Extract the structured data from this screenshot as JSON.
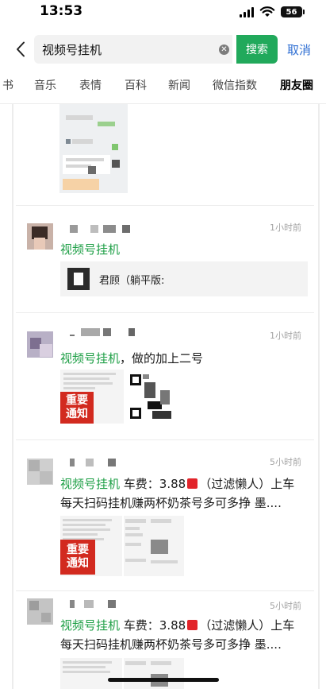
{
  "status": {
    "time": "13:53",
    "battery": "56"
  },
  "search": {
    "query": "视频号挂机",
    "search_label": "搜索",
    "cancel_label": "取消"
  },
  "tabs": [
    {
      "label": "书"
    },
    {
      "label": "音乐"
    },
    {
      "label": "表情"
    },
    {
      "label": "百科"
    },
    {
      "label": "新闻"
    },
    {
      "label": "微信指数"
    },
    {
      "label": "朋友圈",
      "active": true
    }
  ],
  "feed": {
    "posts": [
      {
        "time": "1小时前",
        "keyword": "视频号挂机",
        "link_title": "君顾（躺平版:"
      },
      {
        "time": "1小时前",
        "keyword": "视频号挂机",
        "text": "，做的加上二号",
        "notice": "重要通知"
      },
      {
        "time": "5小时前",
        "keyword": "视频号挂机",
        "line1_before": " 车费：3.88",
        "line1_after": "（过滤懒人）上车",
        "line2": "每天扫码挂机赚两杯奶茶号多可多挣 墨....",
        "notice": "重要通知"
      },
      {
        "time": "5小时前",
        "keyword": "视频号挂机",
        "line1_before": " 车费：3.88",
        "line1_after": "（过滤懒人）上车",
        "line2": "每天扫码挂机赚两杯奶茶号多可多挣 墨...."
      }
    ]
  },
  "colors": {
    "accent": "#21a95b",
    "keyword": "#1e9f46",
    "link": "#2f6fd3",
    "notice": "#d22a1f"
  }
}
